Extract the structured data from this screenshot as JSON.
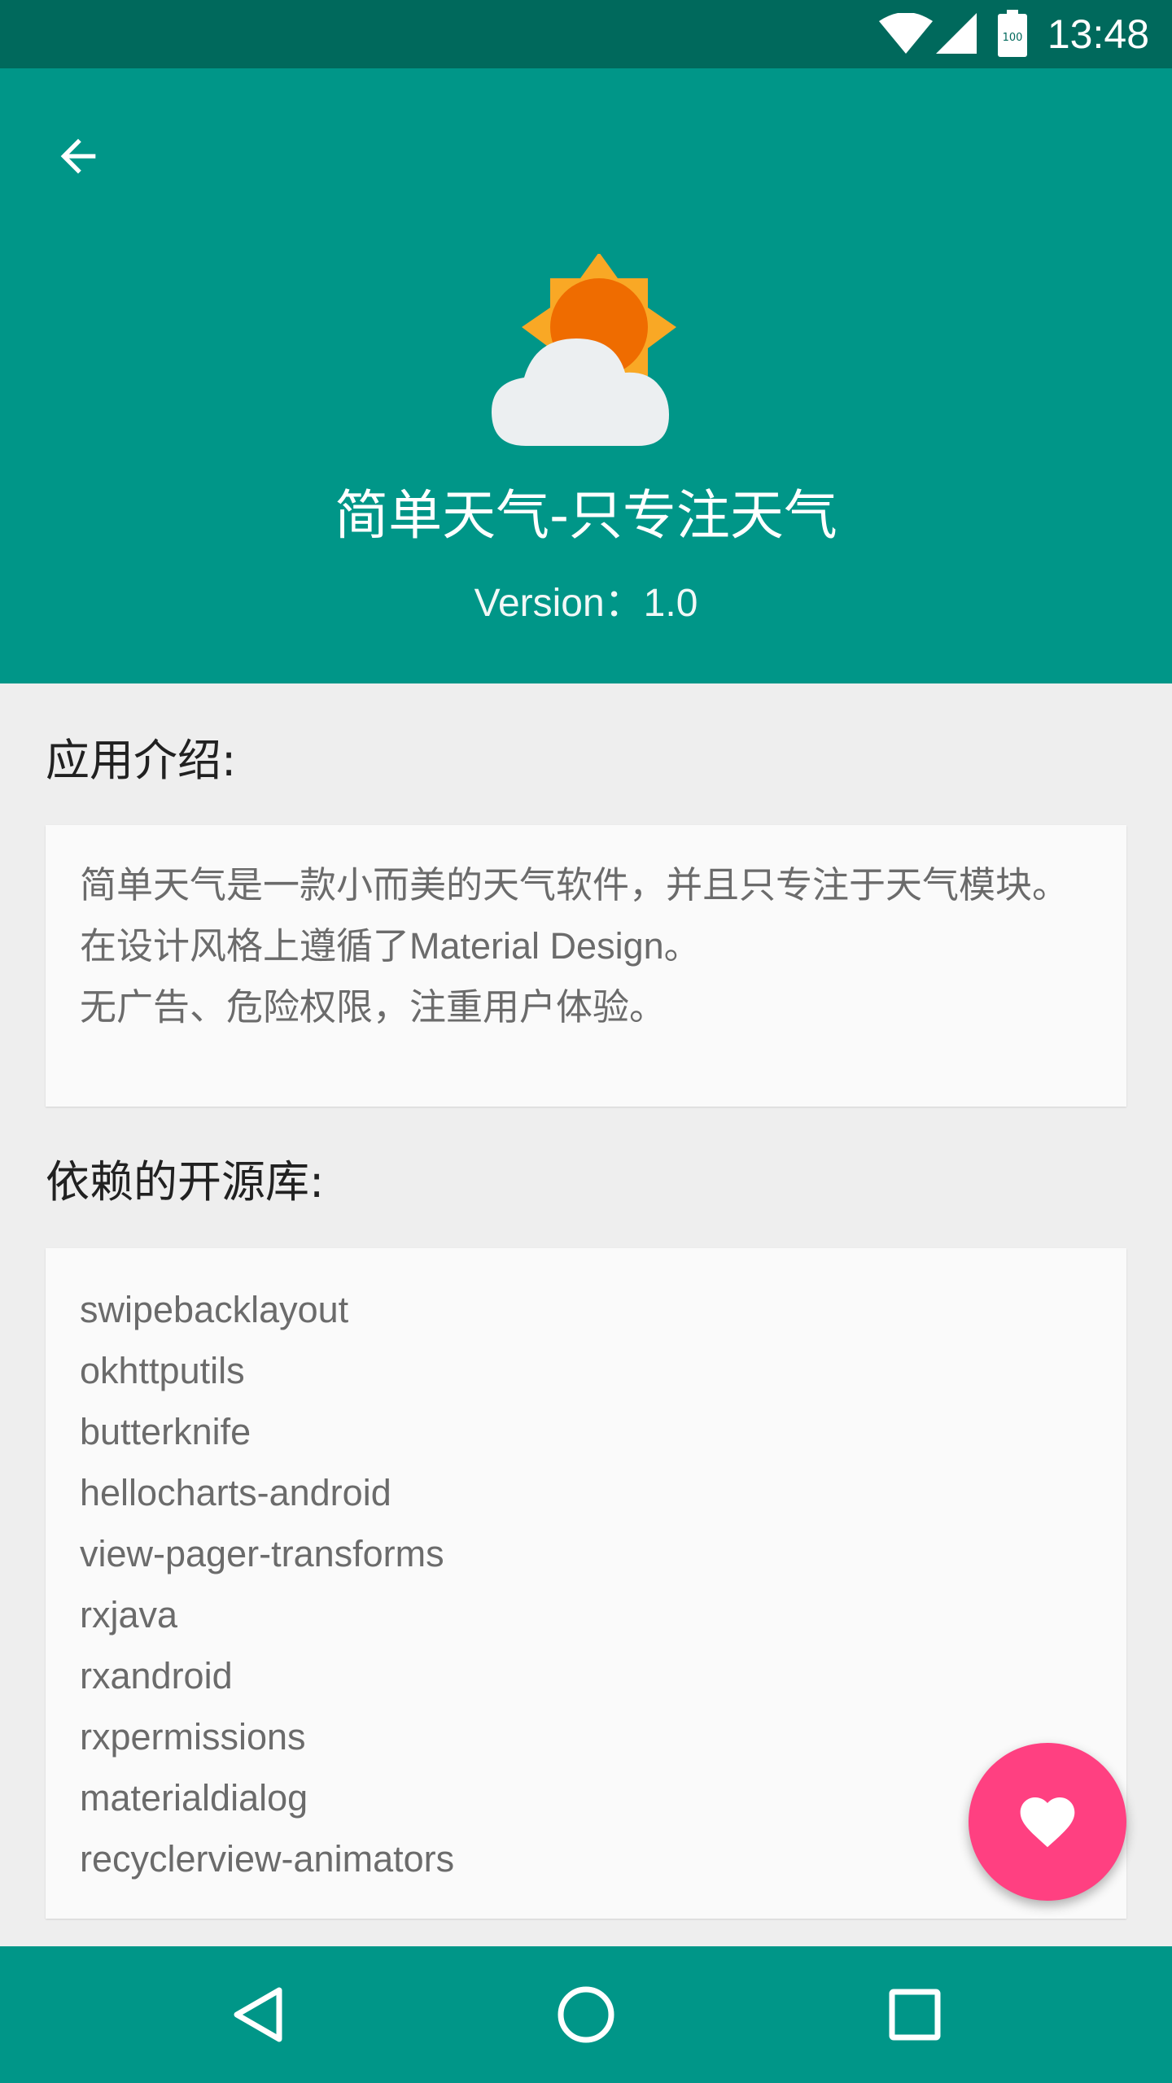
{
  "status_bar": {
    "time": "13:48",
    "battery_level": "100",
    "icons": [
      "wifi-icon",
      "signal-icon",
      "battery-icon"
    ]
  },
  "header": {
    "back_icon": "arrow-back-icon",
    "logo_icon": "sun-cloud-icon",
    "title": "简单天气-只专注天气",
    "version": "Version：1.0"
  },
  "intro": {
    "heading": "应用介绍:",
    "lines": [
      "简单天气是一款小而美的天气软件，并且只专注于天气模块。",
      "在设计风格上遵循了Material Design。",
      "无广告、危险权限，注重用户体验。"
    ]
  },
  "libraries": {
    "heading": "依赖的开源库:",
    "items": [
      "swipebacklayout",
      "okhttputils",
      "butterknife",
      "hellocharts-android",
      "view-pager-transforms",
      "rxjava",
      "rxandroid",
      "rxpermissions",
      "materialdialog",
      "recyclerview-animators"
    ]
  },
  "fab": {
    "icon": "heart-icon"
  },
  "nav_bar": {
    "icons": [
      "back-triangle-icon",
      "home-circle-icon",
      "recents-square-icon"
    ]
  },
  "colors": {
    "primary": "#009688",
    "primary_dark": "#00695c",
    "accent": "#ff4081",
    "background": "#eeeeee",
    "card": "#fafafa"
  }
}
